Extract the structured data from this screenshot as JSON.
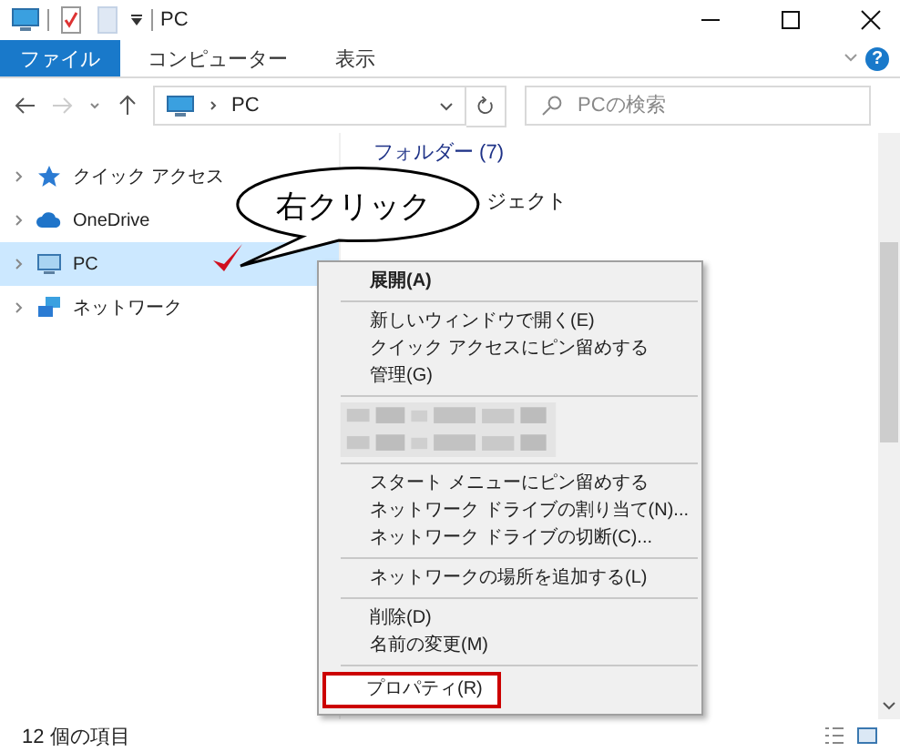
{
  "window": {
    "title": "PC"
  },
  "ribbon_tabs": [
    {
      "label": "ファイル",
      "selected": true
    },
    {
      "label": "コンピューター",
      "selected": false
    },
    {
      "label": "表示",
      "selected": false
    }
  ],
  "help_button": "?",
  "address_bar": {
    "path": "PC"
  },
  "search": {
    "placeholder": "PCの検索"
  },
  "nav_pane": [
    {
      "kind": "star",
      "label": "クイック アクセス",
      "selected": false
    },
    {
      "kind": "cloud",
      "label": "OneDrive",
      "selected": false
    },
    {
      "kind": "pc",
      "label": "PC",
      "selected": true
    },
    {
      "kind": "network",
      "label": "ネットワーク",
      "selected": false
    }
  ],
  "content": {
    "group_header": "フォルダー (7)",
    "items": [
      "ジェクト"
    ]
  },
  "context_menu": [
    {
      "kind": "item",
      "label": "展開(A)",
      "bold": true,
      "highlighted": false
    },
    {
      "kind": "separator"
    },
    {
      "kind": "item",
      "label": "新しいウィンドウで開く(E)",
      "bold": false,
      "highlighted": false
    },
    {
      "kind": "item",
      "label": "クイック アクセスにピン留めする",
      "bold": false,
      "highlighted": false
    },
    {
      "kind": "item",
      "label": "管理(G)",
      "bold": false,
      "highlighted": false
    },
    {
      "kind": "separator"
    },
    {
      "kind": "redacted"
    },
    {
      "kind": "redacted"
    },
    {
      "kind": "separator"
    },
    {
      "kind": "item",
      "label": "スタート メニューにピン留めする",
      "bold": false,
      "highlighted": false
    },
    {
      "kind": "item",
      "label": "ネットワーク ドライブの割り当て(N)...",
      "bold": false,
      "highlighted": false
    },
    {
      "kind": "item",
      "label": "ネットワーク ドライブの切断(C)...",
      "bold": false,
      "highlighted": false
    },
    {
      "kind": "separator"
    },
    {
      "kind": "item",
      "label": "ネットワークの場所を追加する(L)",
      "bold": false,
      "highlighted": false
    },
    {
      "kind": "separator"
    },
    {
      "kind": "item",
      "label": "削除(D)",
      "bold": false,
      "highlighted": false
    },
    {
      "kind": "item",
      "label": "名前の変更(M)",
      "bold": false,
      "highlighted": false
    },
    {
      "kind": "separator"
    },
    {
      "kind": "item",
      "label": "プロパティ(R)",
      "bold": false,
      "highlighted": true
    }
  ],
  "annotation": {
    "callout": "右クリック"
  },
  "status_bar": {
    "item_count": "12 個の項目"
  }
}
